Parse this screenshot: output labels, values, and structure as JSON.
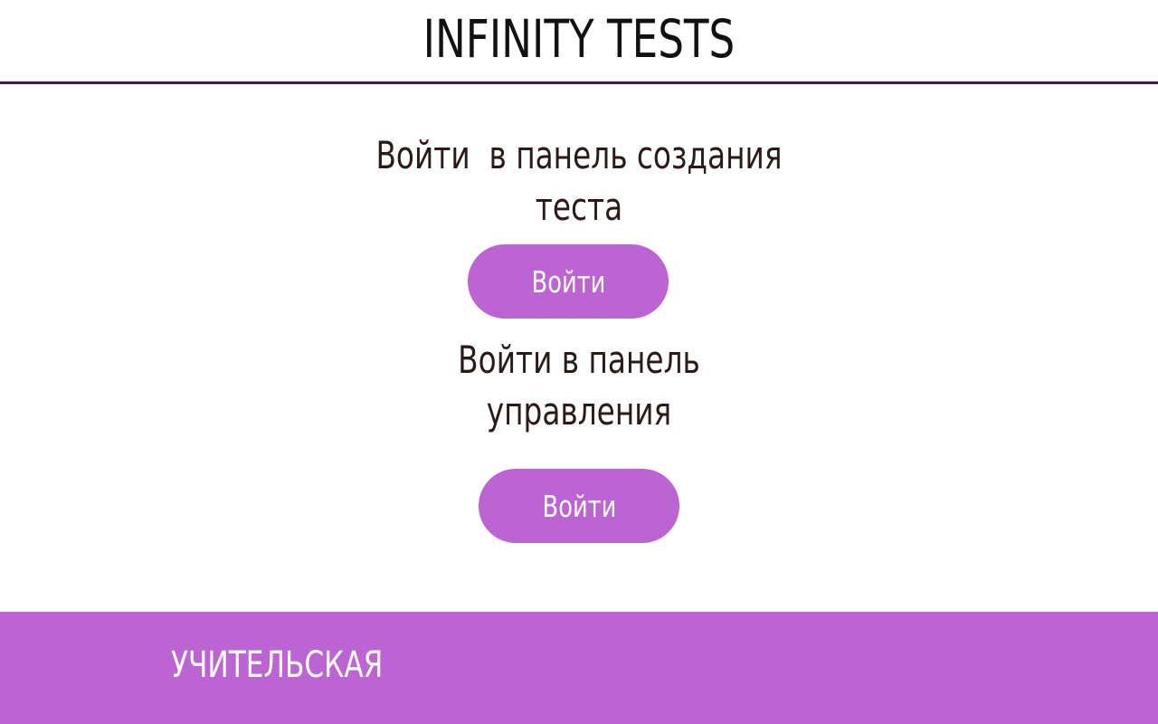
{
  "header": {
    "title": "INFINITY TESTS"
  },
  "sections": [
    {
      "heading_line1": "Войти  в панель создания",
      "heading_line2": "теста",
      "button_label": "Войти"
    },
    {
      "heading_line1": "Войти в панель",
      "heading_line2": "управления",
      "button_label": "Войти"
    }
  ],
  "footer": {
    "label": "УЧИТЕЛЬСКАЯ"
  },
  "colors": {
    "accent": "#bd64d5",
    "header_border": "#4a1450",
    "heading_text": "#2a1a1a"
  }
}
